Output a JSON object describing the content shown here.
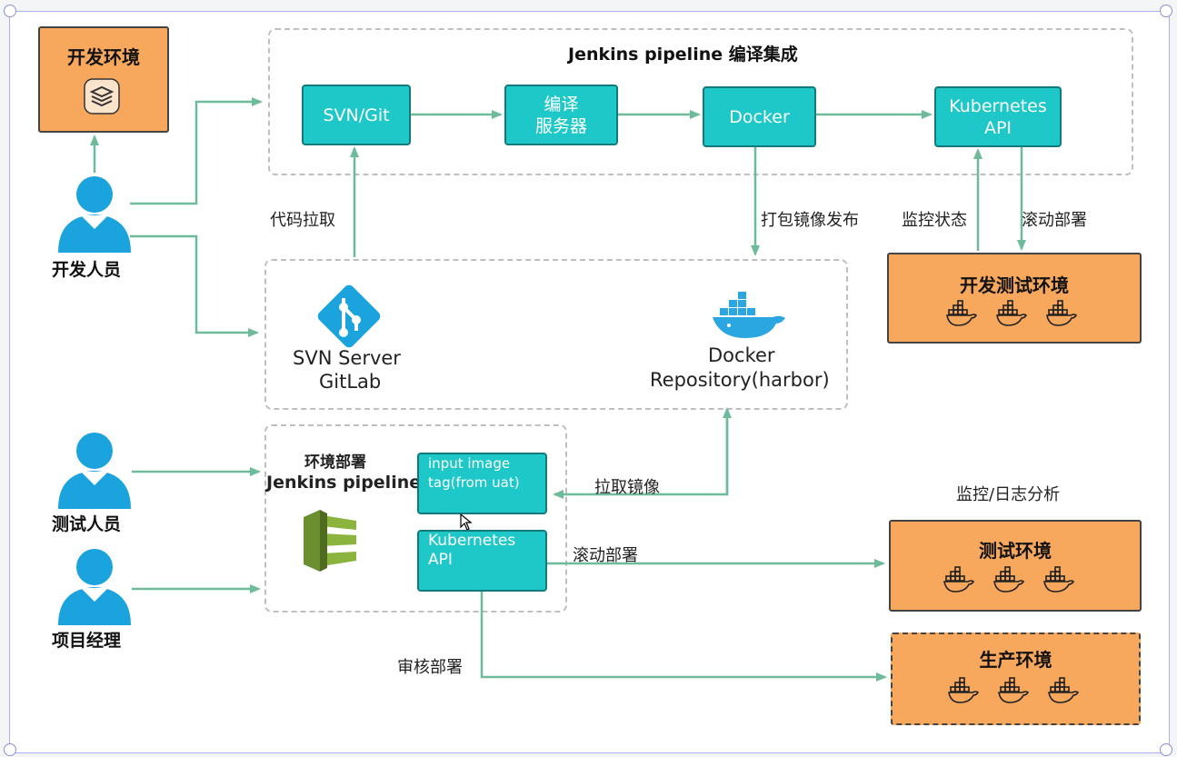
{
  "colors": {
    "teal": "#1ec8c8",
    "orange": "#f7a85d",
    "person_blue": "#1aa3dc",
    "arrow": "#6dbb9b"
  },
  "dev_env": {
    "label": "开发环境",
    "icon": "layers-icon"
  },
  "pipeline": {
    "title": "Jenkins pipeline 编译集成"
  },
  "nodes": {
    "svn_git": "SVN/Git",
    "build_server_line1": "编译",
    "build_server_line2": "服务器",
    "docker": "Docker",
    "k8s_top_line1": "Kubernetes",
    "k8s_top_line2": "API",
    "input_tag_line1": "input image",
    "input_tag_line2": "tag(from uat)",
    "k8s_bottom_line1": "Kubernetes",
    "k8s_bottom_line2": "API"
  },
  "repo": {
    "svn_line1": "SVN Server",
    "svn_line2": "GitLab",
    "docker_line1": "Docker",
    "docker_line2": "Repository(harbor)"
  },
  "deploy": {
    "line1": "环境部署",
    "line2": "Jenkins pipeline"
  },
  "labels": {
    "code_pull": "代码拉取",
    "pack_publish": "打包镜像发布",
    "monitor_status": "监控状态",
    "rolling_top": "滚动部署",
    "pull_image": "拉取镜像",
    "rolling_bottom": "滚动部署",
    "review_deploy": "审核部署",
    "monitor_log": "监控/日志分析"
  },
  "envs": {
    "dev_test": "开发测试环境",
    "test": "测试环境",
    "prod": "生产环境"
  },
  "people": {
    "dev": "开发人员",
    "tester": "测试人员",
    "pm": "项目经理"
  }
}
